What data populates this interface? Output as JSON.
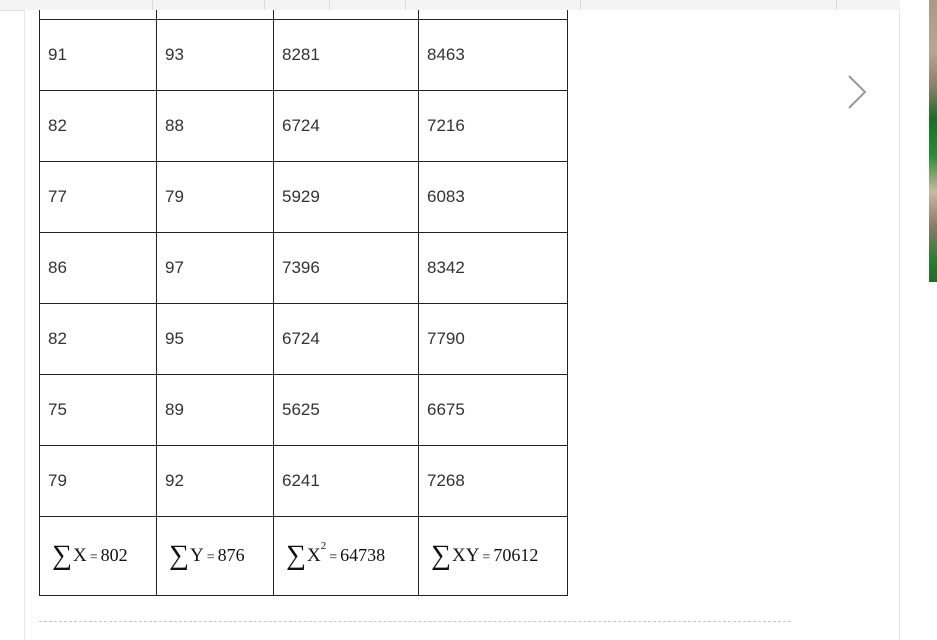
{
  "table": {
    "rows": [
      [
        "91",
        "93",
        "8281",
        "8463"
      ],
      [
        "82",
        "88",
        "6724",
        "7216"
      ],
      [
        "77",
        "79",
        "5929",
        "6083"
      ],
      [
        "86",
        "97",
        "7396",
        "8342"
      ],
      [
        "82",
        "95",
        "6724",
        "7790"
      ],
      [
        "75",
        "89",
        "5625",
        "6675"
      ],
      [
        "79",
        "92",
        "6241",
        "7268"
      ]
    ],
    "sums": {
      "x": {
        "symbol": "∑",
        "var": "X",
        "eq": "=",
        "value": "802"
      },
      "y": {
        "symbol": "∑",
        "var": "Y",
        "eq": "=",
        "value": "876"
      },
      "x2": {
        "symbol": "∑",
        "var": "X",
        "sup": "2",
        "eq": "=",
        "value": "64738"
      },
      "xy": {
        "symbol": "∑",
        "var": "XY",
        "eq": "=",
        "value": "70612"
      }
    }
  },
  "navigation": {
    "next_icon": "chevron-right-icon"
  },
  "colors": {
    "table_border": "#222222",
    "cell_text": "#333333",
    "arrow": "#9a9a9a",
    "page_background": "#ffffff"
  }
}
